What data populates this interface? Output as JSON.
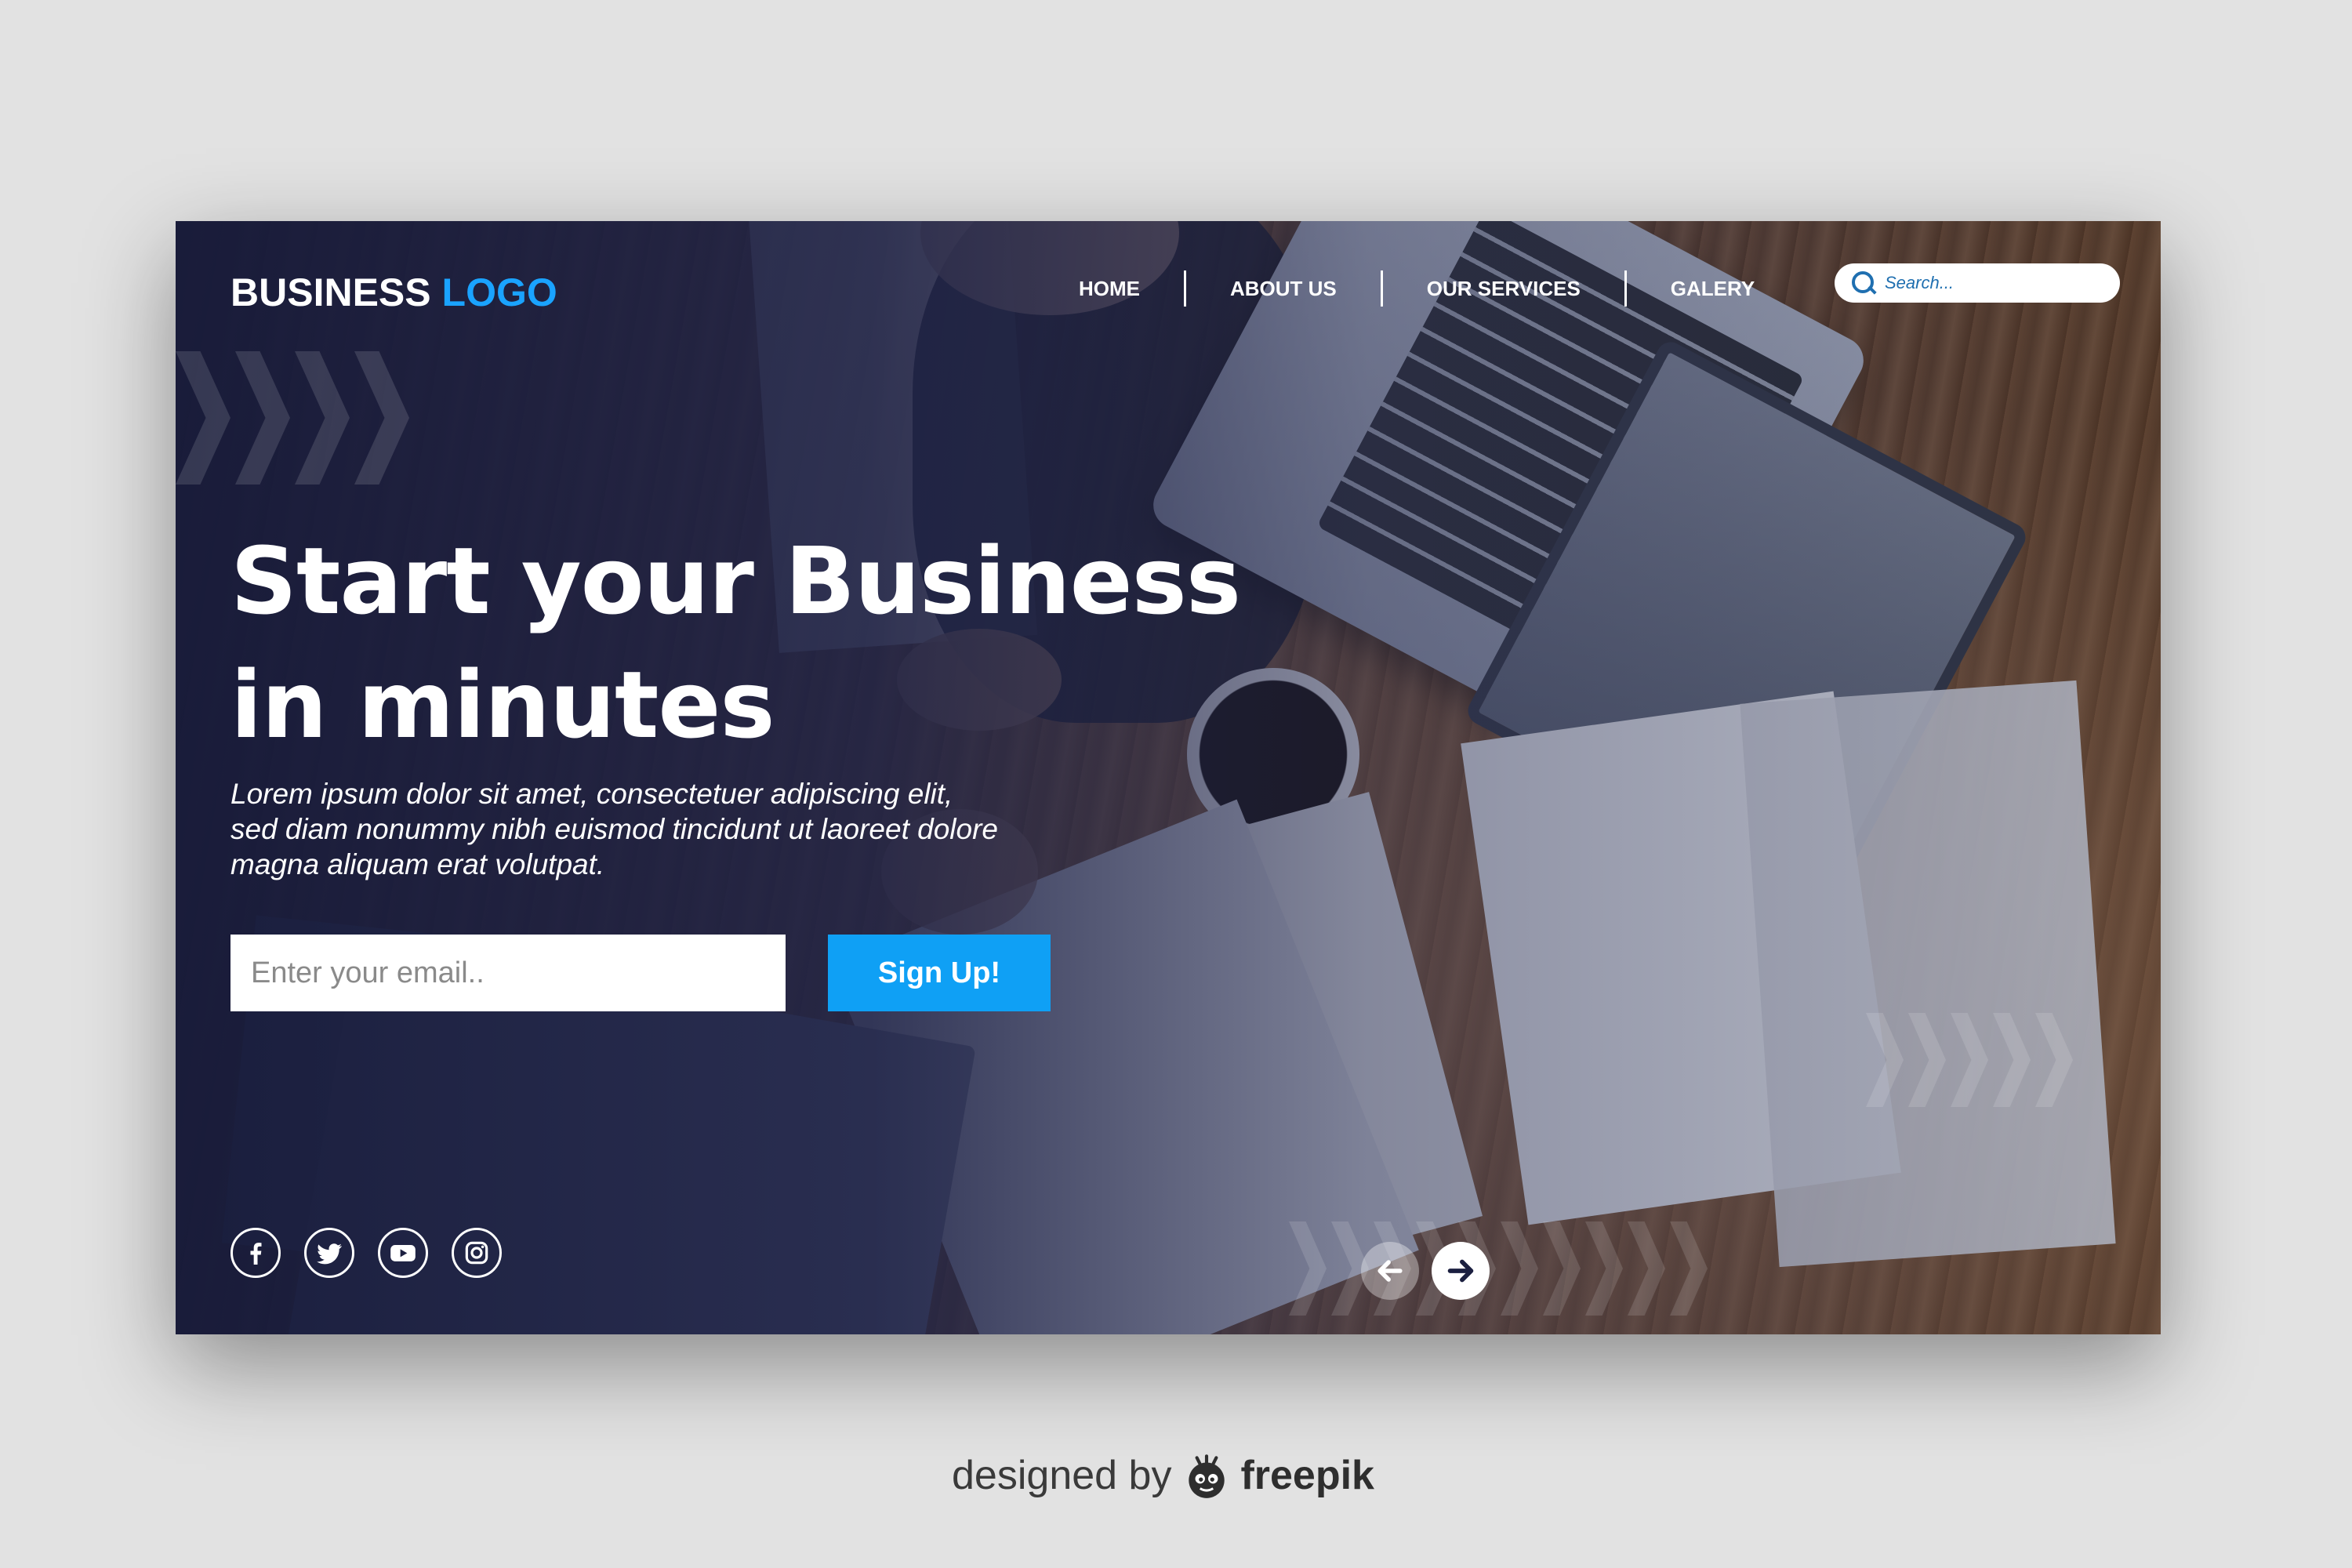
{
  "logo": {
    "word1": "BUSINESS",
    "word2": "LOGO"
  },
  "nav": {
    "items": [
      {
        "label": "HOME"
      },
      {
        "label": "ABOUT US"
      },
      {
        "label": "OUR SERVICES"
      },
      {
        "label": "GALERY"
      }
    ]
  },
  "search": {
    "placeholder": "Search..."
  },
  "hero": {
    "headline_line1": "Start your Business",
    "headline_line2": "in minutes",
    "body": "Lorem ipsum dolor sit amet, consectetuer adipiscing elit, sed diam nonummy nibh euismod tincidunt ut laoreet dolore magna aliquam erat volutpat.",
    "email_placeholder": "Enter your email..",
    "signup_label": "Sign Up!"
  },
  "social": [
    "facebook-icon",
    "twitter-icon",
    "youtube-icon",
    "instagram-icon"
  ],
  "slider": {
    "prev": "arrow-left-icon",
    "next": "arrow-right-icon"
  },
  "credit": {
    "prefix": "designed by",
    "brand": "freepik"
  },
  "colors": {
    "accent": "#1aa3ff",
    "button": "#0fa0f5",
    "page_background": "#e2e2e2",
    "overlay": "#161a3a"
  }
}
